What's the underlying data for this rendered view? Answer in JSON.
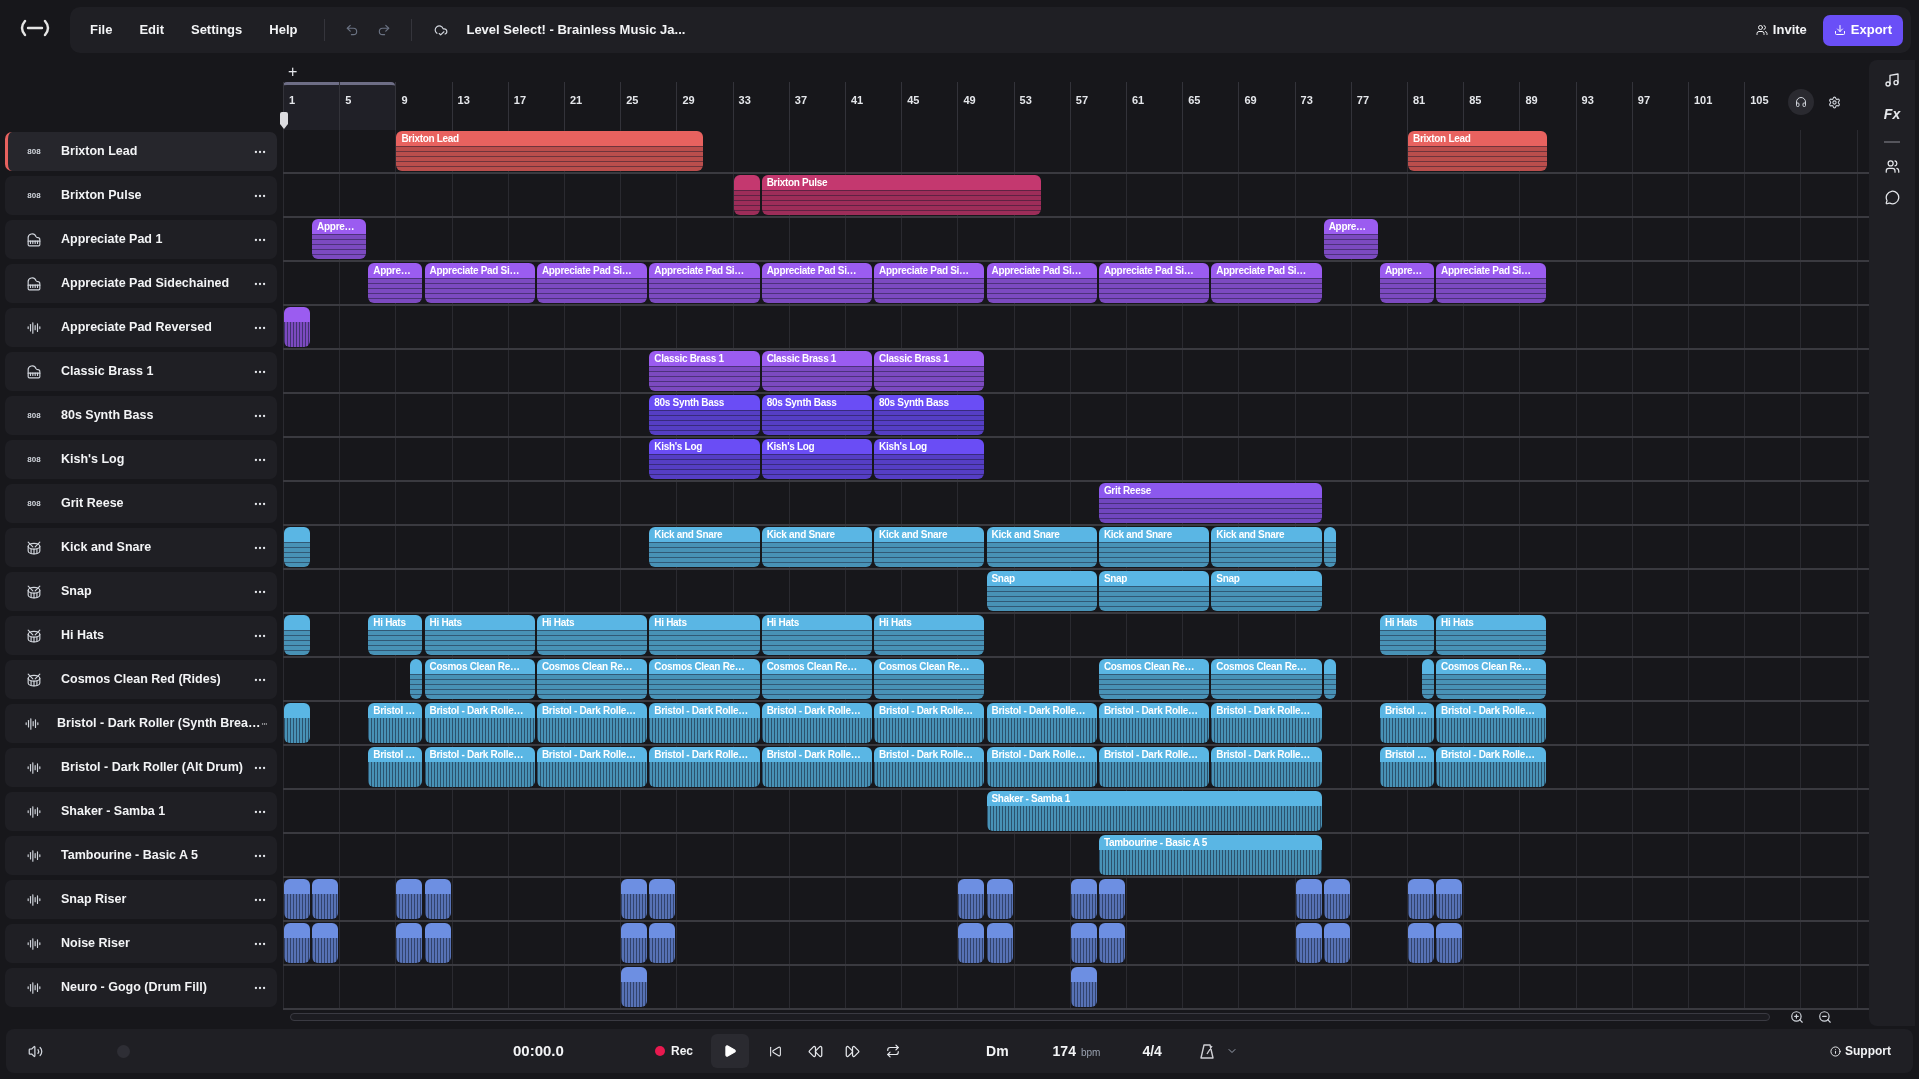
{
  "menu": [
    "File",
    "Edit",
    "Settings",
    "Help"
  ],
  "project_title": "Level Select! - Brainless Music Ja...",
  "invite": "Invite",
  "export": "Export",
  "add_label": "+",
  "ruler": {
    "labels": [
      "1",
      "5",
      "9",
      "13",
      "17",
      "21",
      "25",
      "29",
      "33",
      "37",
      "41",
      "45",
      "49",
      "53",
      "57",
      "61",
      "65",
      "69",
      "73",
      "77",
      "81",
      "85",
      "89",
      "93",
      "97",
      "101",
      "105"
    ],
    "loop_enabled": true
  },
  "tracks": [
    {
      "name": "Brixton Lead",
      "kind": "synth",
      "badge": "808",
      "color": "#e8625f",
      "selected": true,
      "clips": [
        {
          "kind": "region",
          "label": "Brixton Lead"
        },
        {
          "kind": "region",
          "label": "Brixton Lead"
        }
      ]
    },
    {
      "name": "Brixton Pulse",
      "kind": "synth",
      "badge": "808",
      "color": "#c4386f",
      "selected": false,
      "clips": [
        {
          "kind": "stub"
        },
        {
          "kind": "region",
          "label": "Brixton Pulse"
        }
      ]
    },
    {
      "name": "Appreciate Pad 1",
      "kind": "keys",
      "color": "#9b5cf0",
      "selected": false,
      "clips": [
        {
          "kind": "region",
          "label": "Appre…"
        },
        {
          "kind": "region",
          "label": "Appre…"
        }
      ]
    },
    {
      "name": "Appreciate Pad Sidechained",
      "kind": "keys",
      "color": "#9b5cf0",
      "selected": false,
      "clips": [
        {
          "kind": "region",
          "label": "Appre…"
        },
        {
          "kind": "region",
          "label": "Appreciate Pad Si…"
        },
        {
          "kind": "region",
          "label": "Appreciate Pad Si…"
        },
        {
          "kind": "region",
          "label": "Appreciate Pad Si…"
        },
        {
          "kind": "region",
          "label": "Appreciate Pad Si…"
        },
        {
          "kind": "region",
          "label": "Appreciate Pad Si…"
        },
        {
          "kind": "region",
          "label": "Appreciate Pad Si…"
        },
        {
          "kind": "region",
          "label": "Appreciate Pad Si…"
        },
        {
          "kind": "region",
          "label": "Appreciate Pad Si…"
        },
        {
          "kind": "region",
          "label": "Appre…"
        },
        {
          "kind": "region",
          "label": "Appreciate Pad Si…"
        }
      ]
    },
    {
      "name": "Appreciate Pad Reversed",
      "kind": "audio",
      "color": "#9b5cf0",
      "selected": false,
      "clips": [
        {
          "kind": "stub"
        }
      ]
    },
    {
      "name": "Classic Brass 1",
      "kind": "keys",
      "color": "#9b5cf0",
      "selected": false,
      "clips": [
        {
          "kind": "region",
          "label": "Classic Brass 1"
        },
        {
          "kind": "region",
          "label": "Classic Brass 1"
        },
        {
          "kind": "region",
          "label": "Classic Brass 1"
        }
      ]
    },
    {
      "name": "80s Synth Bass",
      "kind": "synth",
      "badge": "808",
      "color": "#6a4df5",
      "selected": false,
      "clips": [
        {
          "kind": "region",
          "label": "80s Synth Bass"
        },
        {
          "kind": "region",
          "label": "80s Synth Bass"
        },
        {
          "kind": "region",
          "label": "80s Synth Bass"
        }
      ]
    },
    {
      "name": "Kish's Log",
      "kind": "synth",
      "badge": "808",
      "color": "#6a4df5",
      "selected": false,
      "clips": [
        {
          "kind": "region",
          "label": "Kish's Log"
        },
        {
          "kind": "region",
          "label": "Kish's Log"
        },
        {
          "kind": "region",
          "label": "Kish's Log"
        }
      ]
    },
    {
      "name": "Grit Reese",
      "kind": "synth",
      "badge": "808",
      "color": "#8c58ee",
      "selected": false,
      "clips": [
        {
          "kind": "region",
          "label": "Grit Reese"
        }
      ]
    },
    {
      "name": "Kick and Snare",
      "kind": "drums",
      "color": "#5ab6e4",
      "selected": false,
      "clips": [
        {
          "kind": "stub"
        },
        {
          "kind": "region",
          "label": "Kick and Snare"
        },
        {
          "kind": "region",
          "label": "Kick and Snare"
        },
        {
          "kind": "region",
          "label": "Kick and Snare"
        },
        {
          "kind": "region",
          "label": "Kick and Snare"
        },
        {
          "kind": "region",
          "label": "Kick and Snare"
        },
        {
          "kind": "region",
          "label": "Kick and Snare"
        },
        {
          "kind": "stub"
        }
      ]
    },
    {
      "name": "Snap",
      "kind": "drums",
      "color": "#5ab6e4",
      "selected": false,
      "clips": [
        {
          "kind": "region",
          "label": "Snap"
        },
        {
          "kind": "region",
          "label": "Snap"
        },
        {
          "kind": "region",
          "label": "Snap"
        }
      ]
    },
    {
      "name": "Hi Hats",
      "kind": "drums",
      "color": "#5ab6e4",
      "selected": false,
      "clips": [
        {
          "kind": "stub"
        },
        {
          "kind": "region",
          "label": "Hi Hats"
        },
        {
          "kind": "region",
          "label": "Hi Hats"
        },
        {
          "kind": "region",
          "label": "Hi Hats"
        },
        {
          "kind": "region",
          "label": "Hi Hats"
        },
        {
          "kind": "region",
          "label": "Hi Hats"
        },
        {
          "kind": "region",
          "label": "Hi Hats"
        },
        {
          "kind": "region",
          "label": "Hi Hats"
        },
        {
          "kind": "region",
          "label": "Hi Hats"
        }
      ]
    },
    {
      "name": "Cosmos Clean Red (Rides)",
      "kind": "drums",
      "color": "#5ab6e4",
      "selected": false,
      "clips": [
        {
          "kind": "stub"
        },
        {
          "kind": "region",
          "label": "Cosmos Clean Re…"
        },
        {
          "kind": "region",
          "label": "Cosmos Clean Re…"
        },
        {
          "kind": "region",
          "label": "Cosmos Clean Re…"
        },
        {
          "kind": "region",
          "label": "Cosmos Clean Re…"
        },
        {
          "kind": "region",
          "label": "Cosmos Clean Re…"
        },
        {
          "kind": "region",
          "label": "Cosmos Clean Re…"
        },
        {
          "kind": "region",
          "label": "Cosmos Clean Re…"
        },
        {
          "kind": "stub"
        },
        {
          "kind": "stub"
        },
        {
          "kind": "region",
          "label": "Cosmos Clean Re…"
        }
      ]
    },
    {
      "name": "Bristol - Dark Roller (Synth Brea…",
      "kind": "audio",
      "color": "#5ab6e4",
      "selected": false,
      "clips": [
        {
          "kind": "stub"
        },
        {
          "kind": "region",
          "label": "Bristol …"
        },
        {
          "kind": "region",
          "label": "Bristol - Dark Rolle…"
        },
        {
          "kind": "region",
          "label": "Bristol - Dark Rolle…"
        },
        {
          "kind": "region",
          "label": "Bristol - Dark Rolle…"
        },
        {
          "kind": "region",
          "label": "Bristol - Dark Rolle…"
        },
        {
          "kind": "region",
          "label": "Bristol - Dark Rolle…"
        },
        {
          "kind": "region",
          "label": "Bristol - Dark Rolle…"
        },
        {
          "kind": "region",
          "label": "Bristol - Dark Rolle…"
        },
        {
          "kind": "region",
          "label": "Bristol - Dark Rolle…"
        },
        {
          "kind": "region",
          "label": "Bristol …"
        },
        {
          "kind": "region",
          "label": "Bristol - Dark Rolle…"
        }
      ]
    },
    {
      "name": "Bristol - Dark Roller (Alt Drum)",
      "kind": "audio",
      "color": "#5ab6e4",
      "selected": false,
      "clips": [
        {
          "kind": "region",
          "label": "Bristol …"
        },
        {
          "kind": "region",
          "label": "Bristol - Dark Rolle…"
        },
        {
          "kind": "region",
          "label": "Bristol - Dark Rolle…"
        },
        {
          "kind": "region",
          "label": "Bristol - Dark Rolle…"
        },
        {
          "kind": "region",
          "label": "Bristol - Dark Rolle…"
        },
        {
          "kind": "region",
          "label": "Bristol - Dark Rolle…"
        },
        {
          "kind": "region",
          "label": "Bristol - Dark Rolle…"
        },
        {
          "kind": "region",
          "label": "Bristol - Dark Rolle…"
        },
        {
          "kind": "region",
          "label": "Bristol - Dark Rolle…"
        },
        {
          "kind": "region",
          "label": "Bristol …"
        },
        {
          "kind": "region",
          "label": "Bristol - Dark Rolle…"
        }
      ]
    },
    {
      "name": "Shaker - Samba 1",
      "kind": "audio",
      "color": "#5ab6e4",
      "selected": false,
      "clips": [
        {
          "kind": "region",
          "label": "Shaker - Samba 1"
        }
      ]
    },
    {
      "name": "Tambourine - Basic A 5",
      "kind": "audio",
      "color": "#5ab6e4",
      "selected": false,
      "clips": [
        {
          "kind": "region",
          "label": "Tambourine - Basic A 5"
        }
      ]
    },
    {
      "name": "Snap Riser",
      "kind": "audio",
      "color": "#6d8fe2",
      "selected": false,
      "clips": [
        {
          "kind": "stub"
        },
        {
          "kind": "stub"
        },
        {
          "kind": "stub"
        },
        {
          "kind": "stub"
        },
        {
          "kind": "stub"
        },
        {
          "kind": "stub"
        },
        {
          "kind": "stub"
        },
        {
          "kind": "stub"
        },
        {
          "kind": "stub"
        },
        {
          "kind": "stub"
        },
        {
          "kind": "stub"
        },
        {
          "kind": "stub"
        },
        {
          "kind": "stub"
        },
        {
          "kind": "stub"
        }
      ]
    },
    {
      "name": "Noise Riser",
      "kind": "audio",
      "color": "#6d8fe2",
      "selected": false,
      "clips": [
        {
          "kind": "stub"
        },
        {
          "kind": "stub"
        },
        {
          "kind": "stub"
        },
        {
          "kind": "stub"
        },
        {
          "kind": "stub"
        },
        {
          "kind": "stub"
        },
        {
          "kind": "stub"
        },
        {
          "kind": "stub"
        },
        {
          "kind": "stub"
        },
        {
          "kind": "stub"
        },
        {
          "kind": "stub"
        },
        {
          "kind": "stub"
        },
        {
          "kind": "stub"
        },
        {
          "kind": "stub"
        }
      ]
    },
    {
      "name": "Neuro - Gogo (Drum Fill)",
      "kind": "audio",
      "color": "#6d8fe2",
      "selected": false,
      "clips": [
        {
          "kind": "stub"
        },
        {
          "kind": "stub"
        }
      ]
    }
  ],
  "transport": {
    "time": "00:00.0",
    "rec": "Rec",
    "key": "Dm",
    "tempo": "174",
    "tempo_unit": "bpm",
    "meter": "4/4",
    "support": "Support"
  },
  "side_panel": {
    "fx": "Fx"
  }
}
